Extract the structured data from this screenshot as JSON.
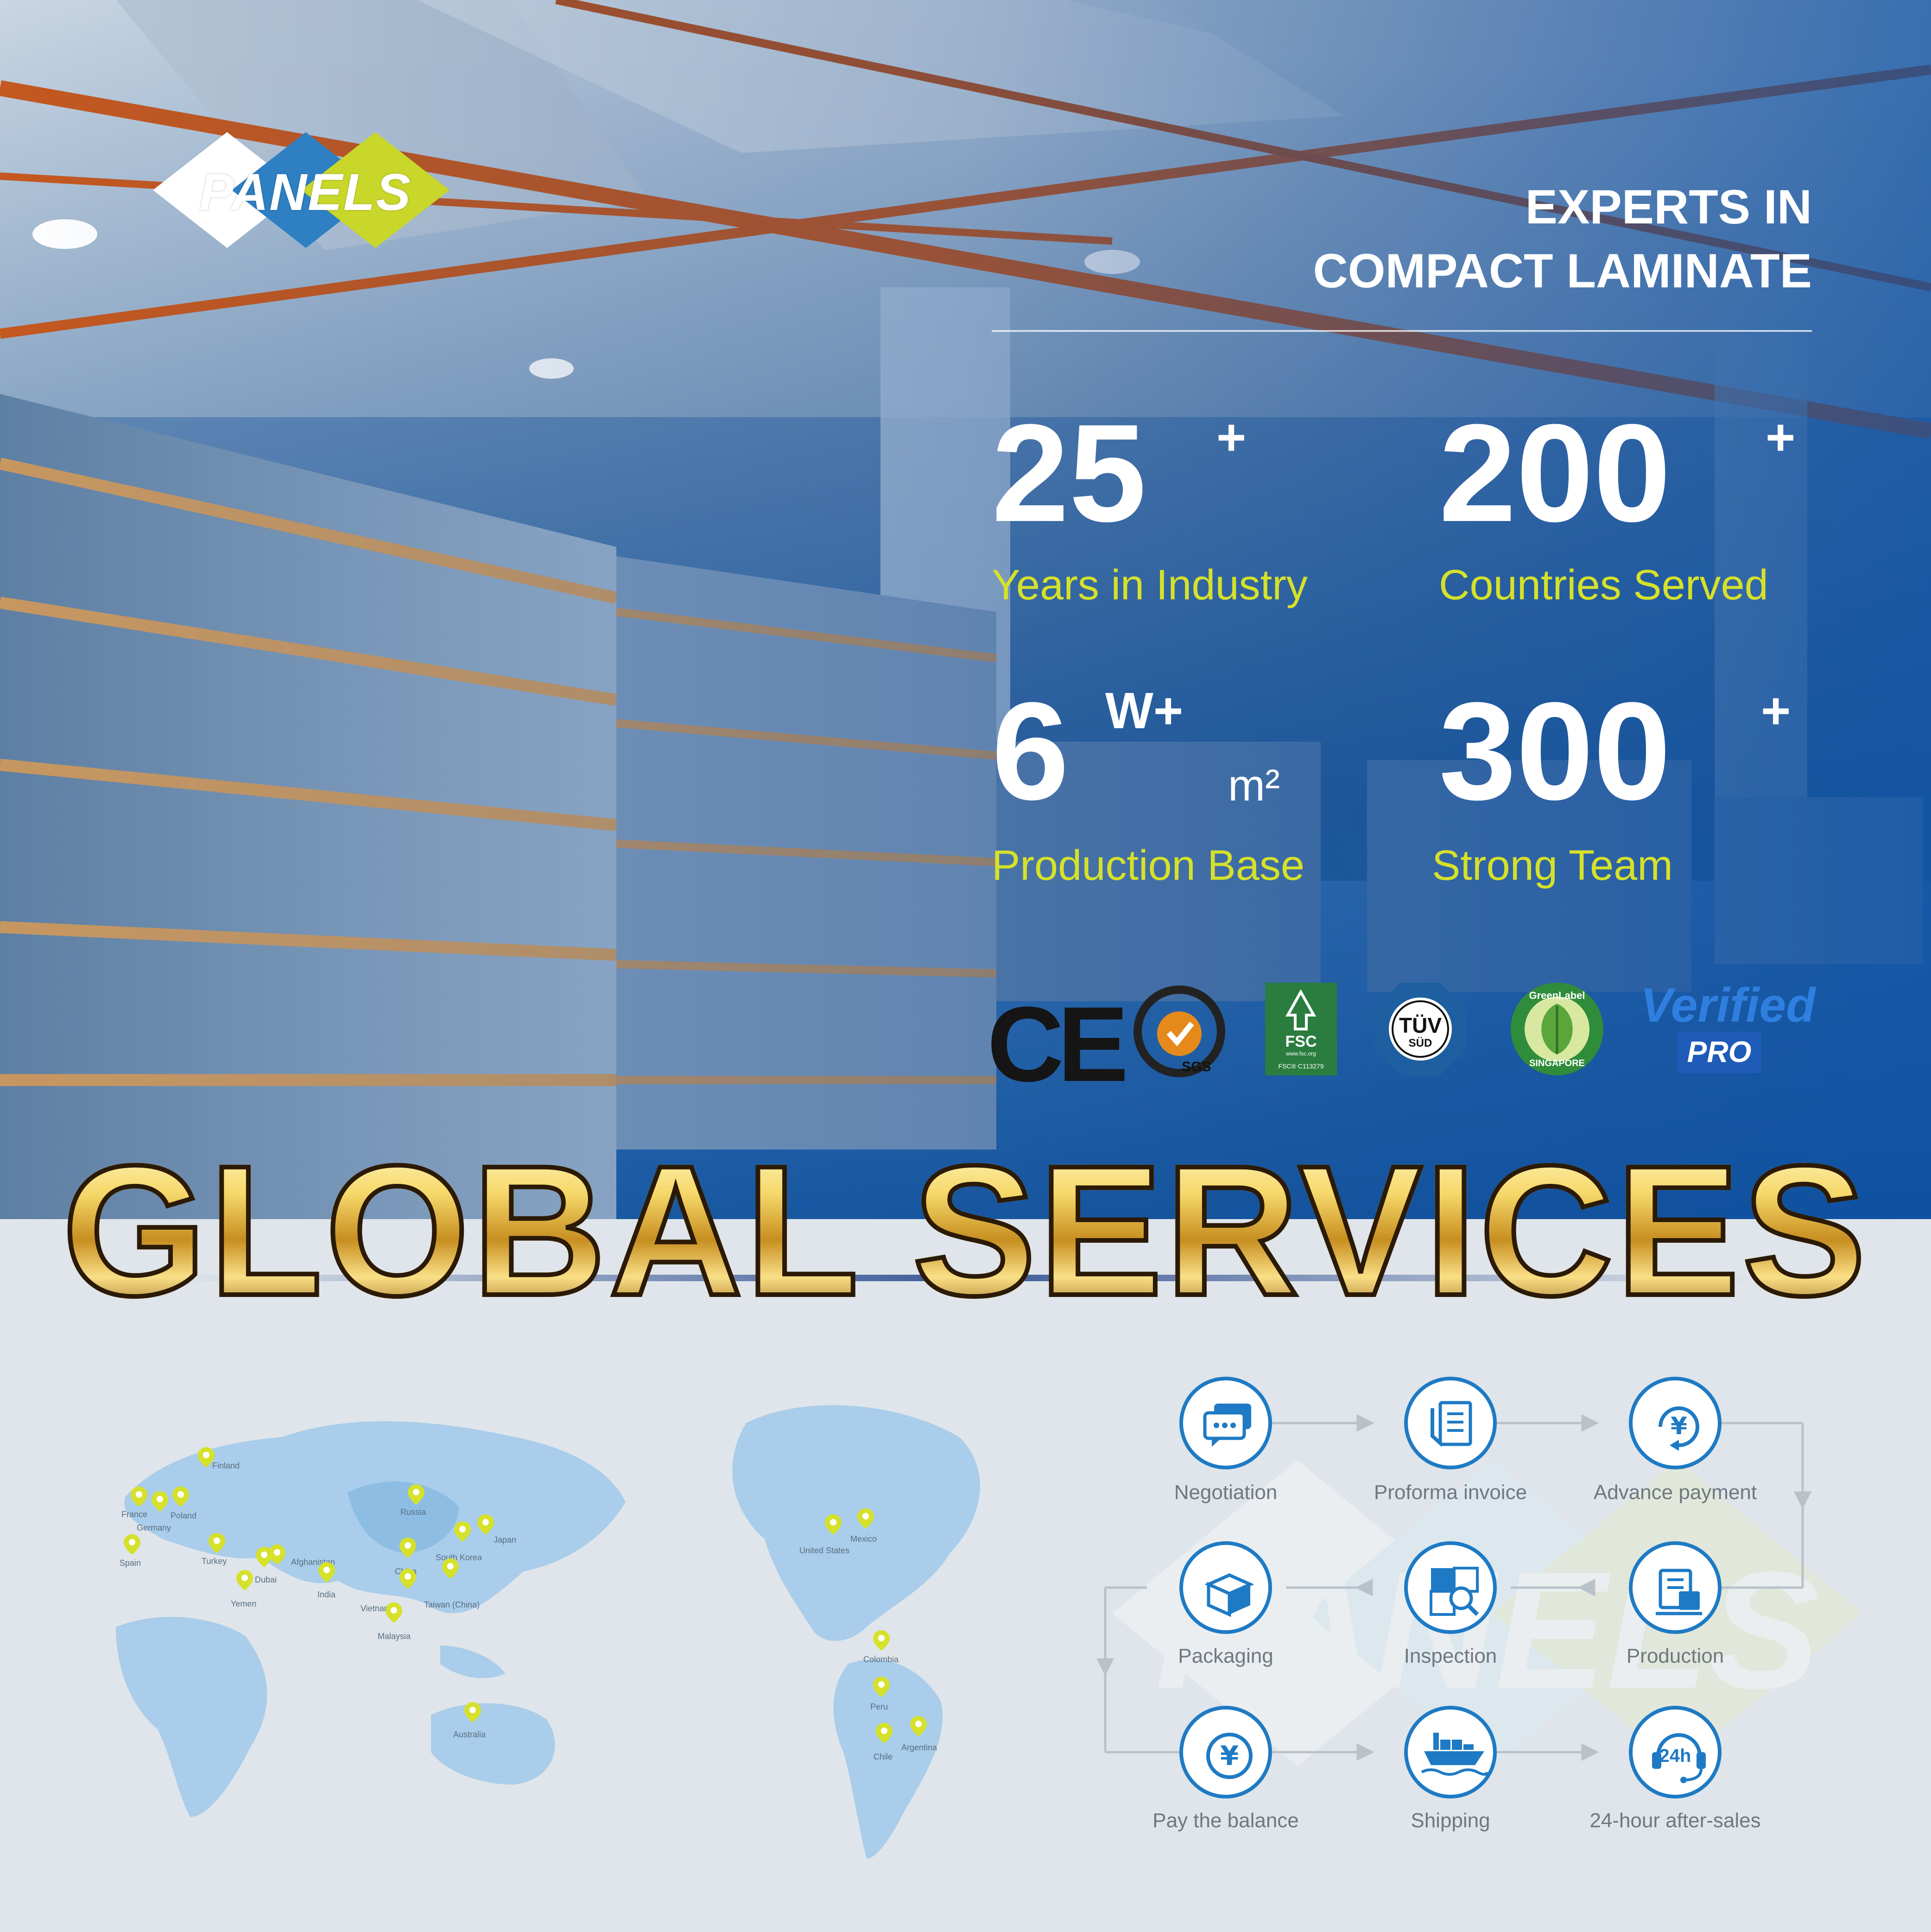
{
  "brand": {
    "logo_text": "PANELS"
  },
  "hero": {
    "headline_line1": "EXPERTS IN",
    "headline_line2": "COMPACT LAMINATE",
    "stats": [
      {
        "number": "25",
        "suffix": "+",
        "label": "Years in Industry"
      },
      {
        "number": "200",
        "suffix": "+",
        "label": "Countries Served"
      },
      {
        "number": "6",
        "suffix": "W+",
        "unit": "m²",
        "label": "Production Base"
      },
      {
        "number": "300",
        "suffix": "+",
        "label": "Strong Team"
      }
    ]
  },
  "certifications": {
    "ce": "CE",
    "sgs": "SGS",
    "fsc": "FSC",
    "fsc_site": "www.fsc.org",
    "fsc_code": "FSC® C113279",
    "tuv": "TÜV",
    "tuv_sub": "SÜD",
    "greenlabel_top": "GreenLabel",
    "greenlabel_bottom": "SINGAPORE",
    "verified": "Verified",
    "pro": "PRO"
  },
  "section_title": "GLOBAL SERVICES",
  "map": {
    "locations": [
      "Finland",
      "Russia",
      "France",
      "Poland",
      "Germany",
      "Spain",
      "Turkey",
      "Afghanistan",
      "Dubai",
      "Yemen",
      "India",
      "China",
      "South Korea",
      "Japan",
      "Vietnam",
      "Taiwan (China)",
      "Malaysia",
      "Australia",
      "Mexico",
      "United States",
      "Colombia",
      "Peru",
      "Chile",
      "Argentina"
    ]
  },
  "process": {
    "steps": [
      "Negotiation",
      "Proforma invoice",
      "Advance payment",
      "Packaging",
      "Inspection",
      "Production",
      "Pay the balance",
      "Shipping",
      "24-hour after-sales"
    ],
    "badge_24": "24h"
  },
  "colors": {
    "accent_yellow": "#d6e12a",
    "primary_blue": "#1e7ac4",
    "hero_blue": "#1e5fa8"
  }
}
